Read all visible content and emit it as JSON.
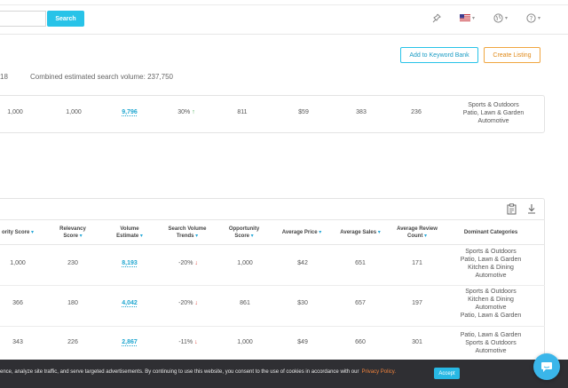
{
  "topbar": {
    "search_button": "Search"
  },
  "actions": {
    "add_to_bank": "Add to Keyword Bank",
    "create_listing": "Create Listing"
  },
  "summary": {
    "count": "18",
    "combined_volume": "Combined estimated search volume: 237,750"
  },
  "primary_row": {
    "c1": "1,000",
    "c2": "1,000",
    "volume": "9,796",
    "trend": "30%",
    "opportunity": "811",
    "price": "$59",
    "sales": "383",
    "reviews": "236",
    "categories": [
      "Sports & Outdoors",
      "Patio, Lawn & Garden",
      "Automotive"
    ]
  },
  "table": {
    "headers": {
      "priority": "ority Score",
      "relevancy_1": "Relevancy",
      "relevancy_2": "Score",
      "volume_1": "Volume",
      "volume_2": "Estimate",
      "trends_1": "Search Volume",
      "trends_2": "Trends",
      "opportunity_1": "Opportunity",
      "opportunity_2": "Score",
      "price": "Average Price",
      "sales": "Average Sales",
      "reviews_1": "Average Review",
      "reviews_2": "Count",
      "categories": "Dominant Categories"
    },
    "rows": [
      {
        "priority": "1,000",
        "relevancy": "230",
        "volume": "8,193",
        "trend": "-20%",
        "opportunity": "1,000",
        "price": "$42",
        "sales": "651",
        "reviews": "171",
        "categories": [
          "Sports & Outdoors",
          "Patio, Lawn & Garden",
          "Kitchen & Dining",
          "Automotive"
        ]
      },
      {
        "priority": "366",
        "relevancy": "180",
        "volume": "4,042",
        "trend": "-20%",
        "opportunity": "861",
        "price": "$30",
        "sales": "657",
        "reviews": "197",
        "categories": [
          "Sports & Outdoors",
          "Kitchen & Dining",
          "Automotive",
          "Patio, Lawn & Garden"
        ]
      },
      {
        "priority": "343",
        "relevancy": "226",
        "volume": "2,867",
        "trend": "-11%",
        "opportunity": "1,000",
        "price": "$49",
        "sales": "660",
        "reviews": "301",
        "categories": [
          "Patio, Lawn & Garden",
          "Sports & Outdoors",
          "Automotive"
        ]
      }
    ]
  },
  "cookie": {
    "message": "ence, analyze site traffic, and serve targeted advertisements. By continuing to use this website, you consent to the use of cookies in accordance with our",
    "policy_link": "Privacy Policy.",
    "accept": "Accept"
  },
  "colors": {
    "accent": "#28c3e8",
    "orange": "#f0a640",
    "trend_up": "#3aa94a",
    "trend_down": "#e0463c"
  }
}
